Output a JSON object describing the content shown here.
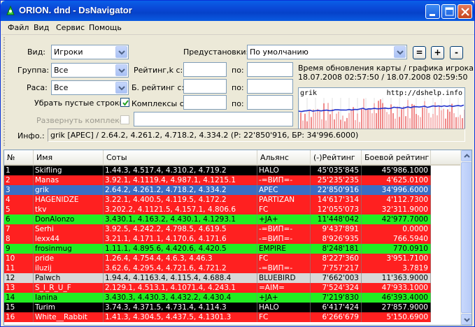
{
  "window": {
    "title": "ORION. dnd - DsNavigator"
  },
  "menu": [
    "Файл",
    "Вид",
    "Сервис",
    "Помощь"
  ],
  "filters": {
    "view_label": "Вид:",
    "view_value": "Игроки",
    "group_label": "Группа:",
    "group_value": "Все",
    "race_label": "Раса:",
    "race_value": "Все",
    "remove_empty_label": "Убрать пустые строки",
    "expand_label": "Развернуть комплексы",
    "rating_from_label": "Рейтинг,k с:",
    "battle_rating_from_label": "Б. рейтинг с:",
    "complexes_from_label": "Комплексы с:",
    "to_label": "по:",
    "presets_label": "Предустановки:",
    "presets_value": "По умолчанию",
    "btn_eq": "=",
    "btn_plus": "+",
    "btn_minus": "-",
    "update_caption": "Время обновления карты / графика игрока",
    "update_times": "18.07.2008 02:57:50 / 18.07.2008 02:59:50",
    "info_label": "Инфо.:",
    "info_value": "grik [APEC] / 2.64.2, 4.261.2, 4.718.2, 4.334.2 (Р: 22'850'916, БР: 34'996.6000)"
  },
  "graph": {
    "player": "grik",
    "url": "http://dshelp.info"
  },
  "colors": {
    "black": "#000000",
    "red": "#ff2020",
    "green": "#22ee22",
    "gray": "#d8d8d8",
    "selected": "#3a6ec4"
  },
  "table": {
    "headers": [
      "№",
      "Имя",
      "Соты",
      "Альянс",
      "(-)Рейтинг",
      "Боевой рейтинг"
    ],
    "rows": [
      {
        "n": "1",
        "name": "Skifling",
        "soty": "1.44.3, 4.517.4, 4.310.2, 4.719.2",
        "alliance": "HALO",
        "rating": "45'035'845",
        "battle": "45'986.1000",
        "style": "black"
      },
      {
        "n": "2",
        "name": "Manas",
        "soty": "3.92.1, 4.1119.4, 4.987.1, 4.1215.1",
        "alliance": "-=ВИП=-",
        "rating": "25'235'235",
        "battle": "4'625.0100",
        "style": "red"
      },
      {
        "n": "3",
        "name": "grik",
        "soty": "2.64.2, 4.261.2, 4.718.2, 4.334.2",
        "alliance": "APEC",
        "rating": "22'850'916",
        "battle": "34'996.6000",
        "style": "selected"
      },
      {
        "n": "4",
        "name": "HAGENIDZE",
        "soty": "3.22.1, 4.400.5, 4.119.5, 4.172.2",
        "alliance": "PARTIZAN",
        "rating": "14'617'314",
        "battle": "4'112.7300",
        "style": "red"
      },
      {
        "n": "5",
        "name": "tkv",
        "soty": "3.202.2, 4.1121.5, 4.157.1, 4.806.6",
        "alliance": "FC",
        "rating": "12'055'073",
        "battle": "32'311.9000",
        "style": "red"
      },
      {
        "n": "6",
        "name": "DonAlonzo",
        "soty": "3.430.1, 4.163.2, 4.430.1, 4.1293.1",
        "alliance": "+JA+",
        "rating": "11'448'042",
        "battle": "42'977.7000",
        "style": "green"
      },
      {
        "n": "7",
        "name": "Serhi",
        "soty": "3.92.5, 4.242.2, 4.798.5, 4.619.5",
        "alliance": "-=ВИП=-",
        "rating": "9'437'891",
        "battle": "0.0000",
        "style": "red"
      },
      {
        "n": "8",
        "name": "lexx44",
        "soty": "3.21.1, 4.171.1, 4.170.6, 4.171.6",
        "alliance": "-=ВИП=-",
        "rating": "8'926'935",
        "battle": "766.5940",
        "style": "red"
      },
      {
        "n": "9",
        "name": "frosinmug",
        "soty": "1.11.1, 4.895.6, 4.420.6, 4.420.5",
        "alliance": "EMPIRE",
        "rating": "8'248'181",
        "battle": "770.0910",
        "style": "green"
      },
      {
        "n": "10",
        "name": "pride",
        "soty": "1.26.4, 4.754.4, 4.6.3, 4.46.3",
        "alliance": "FC",
        "rating": "8'227'360",
        "battle": "3'951.7100",
        "style": "red"
      },
      {
        "n": "11",
        "name": "iluzij",
        "soty": "3.62.6, 4.295.4, 4.721.6, 4.721.2",
        "alliance": "-=ВИП=-",
        "rating": "7'757'217",
        "battle": "3.7819",
        "style": "red"
      },
      {
        "n": "12",
        "name": "Palwch",
        "soty": "1.94.4, 4.1163.4, 4.115.4, 4.688.4",
        "alliance": "BLUEBIRD",
        "rating": "7'662'003",
        "battle": "11'363.9000",
        "style": "gray"
      },
      {
        "n": "13",
        "name": "S_I_R_U_F",
        "soty": "2.129.1, 4.513.1, 4.1071.4, 4.243.1",
        "alliance": "=AIM=",
        "rating": "7'524'324",
        "battle": "47'933.1000",
        "style": "red"
      },
      {
        "n": "14",
        "name": "Ianina",
        "soty": "3.430.3, 4.430.3, 4.432.2, 4.430.4",
        "alliance": "+JA+",
        "rating": "7'219'830",
        "battle": "46'393.4000",
        "style": "green"
      },
      {
        "n": "15",
        "name": "Turim",
        "soty": "3.74.3, 4.371.5, 4.731.4, 4.114.3",
        "alliance": "HALO",
        "rating": "6'417'424",
        "battle": "27'857.9000",
        "style": "black"
      },
      {
        "n": "16",
        "name": "White__Rabbit",
        "soty": "1.41.3, 4.304.5, 4.437.5, 4.1301.3",
        "alliance": "FC",
        "rating": "6'266'679",
        "battle": "5'150.6900",
        "style": "red"
      }
    ]
  }
}
